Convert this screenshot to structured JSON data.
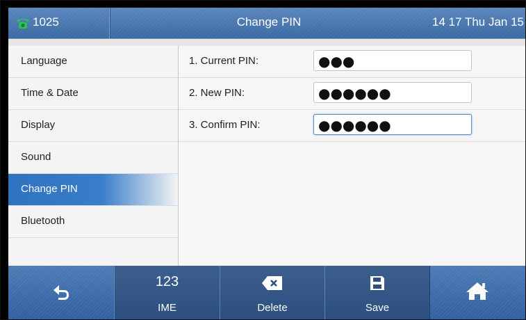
{
  "statusbar": {
    "account": "1025",
    "title": "Change PIN",
    "datetime": "14 17 Thu Jan 15",
    "phone_icon": "phone-handset-icon"
  },
  "sidebar": {
    "items": [
      {
        "label": "Language",
        "active": false
      },
      {
        "label": "Time & Date",
        "active": false
      },
      {
        "label": "Display",
        "active": false
      },
      {
        "label": "Sound",
        "active": false
      },
      {
        "label": "Change PIN",
        "active": true
      },
      {
        "label": "Bluetooth",
        "active": false
      }
    ]
  },
  "form": {
    "fields": [
      {
        "label": "1. Current PIN:",
        "value": "●●●",
        "focused": false
      },
      {
        "label": "2. New PIN:",
        "value": "●●●●●●",
        "focused": false
      },
      {
        "label": "3. Confirm PIN:",
        "value": "●●●●●●",
        "focused": true
      }
    ]
  },
  "softkeys": {
    "back": {
      "icon": "back-arrow-icon"
    },
    "ime": {
      "top": "123",
      "label": "IME"
    },
    "delete": {
      "label": "Delete",
      "icon": "backspace-icon"
    },
    "save": {
      "label": "Save",
      "icon": "floppy-disk-icon"
    },
    "home": {
      "icon": "home-icon"
    }
  },
  "colors": {
    "accent": "#3a7dc8",
    "bar": "#3f6fa9"
  }
}
